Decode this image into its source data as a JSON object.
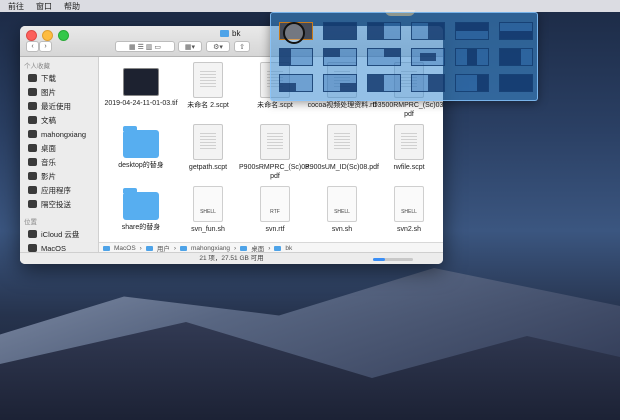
{
  "menubar": {
    "items": [
      "前往",
      "窗口",
      "帮助"
    ]
  },
  "window": {
    "title": "bk"
  },
  "sidebar": {
    "section_favorites": "个人收藏",
    "favorites": [
      {
        "label": "下载",
        "icon": "download-icon"
      },
      {
        "label": "图片",
        "icon": "pictures-icon"
      },
      {
        "label": "最近使用",
        "icon": "recents-icon"
      },
      {
        "label": "文稿",
        "icon": "documents-icon"
      },
      {
        "label": "mahongxiang",
        "icon": "home-icon"
      },
      {
        "label": "桌面",
        "icon": "desktop-icon"
      },
      {
        "label": "音乐",
        "icon": "music-icon"
      },
      {
        "label": "影片",
        "icon": "movies-icon"
      },
      {
        "label": "应用程序",
        "icon": "applications-icon"
      },
      {
        "label": "隔空投送",
        "icon": "airdrop-icon"
      }
    ],
    "section_locations": "位置",
    "locations": [
      {
        "label": "iCloud 云盘",
        "icon": "cloud-icon"
      },
      {
        "label": "MacOS",
        "icon": "disk-icon"
      }
    ]
  },
  "files": [
    {
      "name": "2019-04-24-11-01-03.tif",
      "kind": "image"
    },
    {
      "name": "未命名 2.scpt",
      "kind": "doc"
    },
    {
      "name": "未命名.scpt",
      "kind": "doc"
    },
    {
      "name": "cocoa视频处理资料.rtf",
      "kind": "doc"
    },
    {
      "name": "D3500RMPRC_(Sc)03.pdf",
      "kind": "doc"
    },
    {
      "name": "desktop的替身",
      "kind": "folder"
    },
    {
      "name": "getpath.scpt",
      "kind": "doc"
    },
    {
      "name": "P900sRMPRC_(Sc)08.pdf",
      "kind": "doc"
    },
    {
      "name": "P900sUM_ID(Sc)08.pdf",
      "kind": "doc"
    },
    {
      "name": "rwfile.scpt",
      "kind": "doc"
    },
    {
      "name": "share的替身",
      "kind": "folder"
    },
    {
      "name": "svn_fun.sh",
      "kind": "shell",
      "tag": "SHELL"
    },
    {
      "name": "svn.rtf",
      "kind": "shell",
      "tag": "RTF"
    },
    {
      "name": "svn.sh",
      "kind": "shell",
      "tag": "SHELL"
    },
    {
      "name": "svn2.sh",
      "kind": "shell",
      "tag": "SHELL"
    }
  ],
  "pathbar": [
    "MacOS",
    "用户",
    "mahongxiang",
    "桌面",
    "bk"
  ],
  "status": "21 项，27.51 GB 可用",
  "zoom_level": 0.3
}
